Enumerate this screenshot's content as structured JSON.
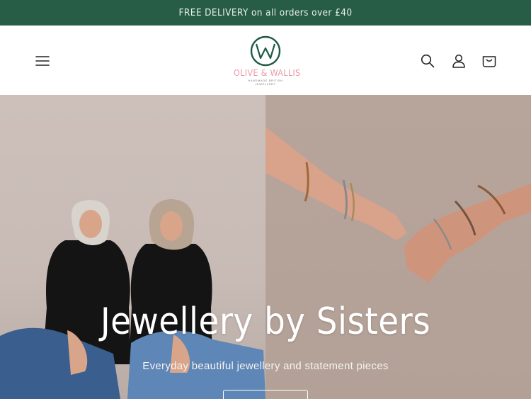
{
  "announcement": {
    "text": "FREE DELIVERY on all orders over £40"
  },
  "header": {
    "menu_icon": "hamburger-icon",
    "logo": {
      "monogram": "&W",
      "wordmark": "OLIVE & WALLIS",
      "tagline_line1": "HANDMADE BRITISH",
      "tagline_line2": "JEWELLERY"
    },
    "actions": [
      "search-icon",
      "account-icon",
      "cart-icon"
    ]
  },
  "hero": {
    "title": "Jewellery by Sisters",
    "subtitle": "Everyday beautiful jewellery and statement pieces"
  },
  "colors": {
    "announcement_bg": "#275d47",
    "logo_green": "#1f5a45",
    "logo_pink": "#e89aa9"
  }
}
